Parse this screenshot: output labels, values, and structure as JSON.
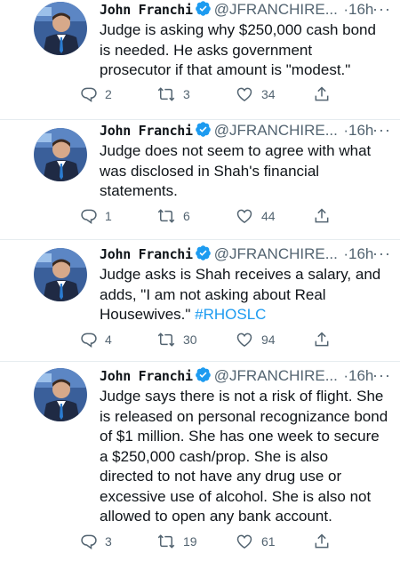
{
  "author": {
    "name": "John Franchi",
    "handle": "@JFRANCHIRE...",
    "separator": "·"
  },
  "tweets": [
    {
      "time": "16h",
      "text": "Judge is asking why $250,000 cash bond\nis needed.  He asks government\nprosecutor if that amount is \"modest.\"",
      "hashtag": "",
      "replies": "2",
      "retweets": "3",
      "likes": "34"
    },
    {
      "time": "16h",
      "text": "Judge does not seem to agree with what\nwas disclosed in Shah's financial\nstatements.",
      "hashtag": "",
      "replies": "1",
      "retweets": "6",
      "likes": "44"
    },
    {
      "time": "16h",
      "text": "Judge asks is Shah receives a salary, and\nadds, \"I am not asking about Real\nHousewives.\" ",
      "hashtag": "#RHOSLC",
      "replies": "4",
      "retweets": "30",
      "likes": "94"
    },
    {
      "time": "16h",
      "text": "Judge says there is not a risk of flight.  She\nis released on personal recognizance bond\nof $1 million.  She has one week to secure\na $250,000 cash/prop.  She is also\ndirected to not have any drug use or\nexcessive use of alcohol.  She is also not\nallowed to open any bank account.",
      "hashtag": "",
      "replies": "3",
      "retweets": "19",
      "likes": "61"
    }
  ],
  "colors": {
    "verified": "#1d9bf0",
    "secondary_text": "#536471",
    "link": "#1d9bf0"
  },
  "icons": {
    "reply": "reply-icon",
    "retweet": "retweet-icon",
    "like": "heart-icon",
    "share": "share-icon",
    "verified": "verified-badge-icon",
    "more": "more-options-icon"
  }
}
